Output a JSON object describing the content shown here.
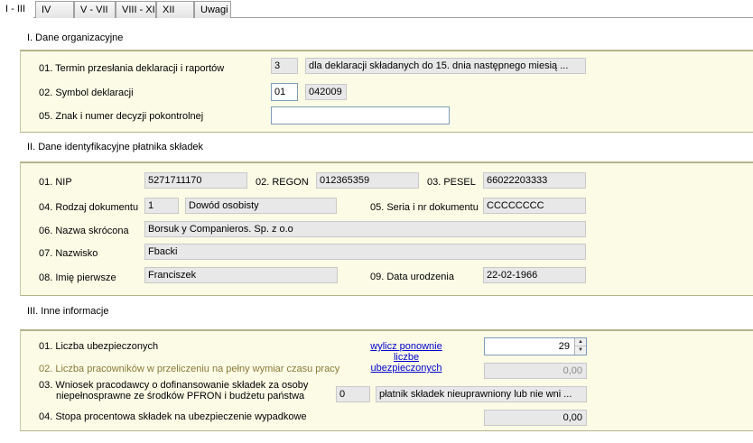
{
  "tabs": {
    "active": "I - III",
    "items": [
      "IV",
      "V - VII",
      "VIII - XI",
      "XII",
      "Uwagi"
    ]
  },
  "section1": {
    "title": "I. Dane organizacyjne",
    "row1": {
      "label": "01. Termin przesłania deklaracji i raportów",
      "code": "3",
      "desc": "dla deklaracji składanych do 15. dnia następnego miesią ..."
    },
    "row2": {
      "label": "02. Symbol deklaracji",
      "code": "01",
      "value": "042009"
    },
    "row3": {
      "label": "05. Znak i numer decyzji pokontrolnej",
      "value": ""
    }
  },
  "section2": {
    "title": "II. Dane identyfikacyjne płatnika składek",
    "nip": {
      "label": "01. NIP",
      "value": "5271711170"
    },
    "regon": {
      "label": "02. REGON",
      "value": "012365359"
    },
    "pesel": {
      "label": "03. PESEL",
      "value": "66022203333"
    },
    "doc_type": {
      "label": "04. Rodzaj dokumentu",
      "code": "1",
      "value": "Dowód osobisty"
    },
    "doc_series": {
      "label": "05. Seria i nr dokumentu",
      "value": "CCCCCCCC"
    },
    "short_name": {
      "label": "06. Nazwa skrócona",
      "value": "Borsuk y Companieros. Sp. z o.o"
    },
    "surname": {
      "label": "07. Nazwisko",
      "value": "Fbacki"
    },
    "first_name": {
      "label": "08. Imię pierwsze",
      "value": "Franciszek"
    },
    "birth_date": {
      "label": "09. Data urodzenia",
      "value": "22-02-1966"
    }
  },
  "section3": {
    "title": "III. Inne informacje",
    "insured": {
      "label": "01. Liczba ubezpieczonych",
      "value": "29"
    },
    "recalc_link": {
      "line1": "wylicz ponownie liczbe",
      "line2": "ubezpieczonych"
    },
    "employees": {
      "label": "02. Liczba pracowników w przeliczeniu na pełny wymiar czasu pracy",
      "value": "0,00"
    },
    "pfron": {
      "label_line1": "03. Wniosek pracodawcy o dofinansowanie składek za osoby",
      "label_line2": "niepełnosprawne ze środków PFRON i budżetu państwa",
      "code": "0",
      "value": "płatnik składek nieuprawniony lub nie wni ..."
    },
    "accident_rate": {
      "label": "04. Stopa procentowa składek na ubezpieczenie wypadkowe",
      "value": "0,00"
    }
  }
}
